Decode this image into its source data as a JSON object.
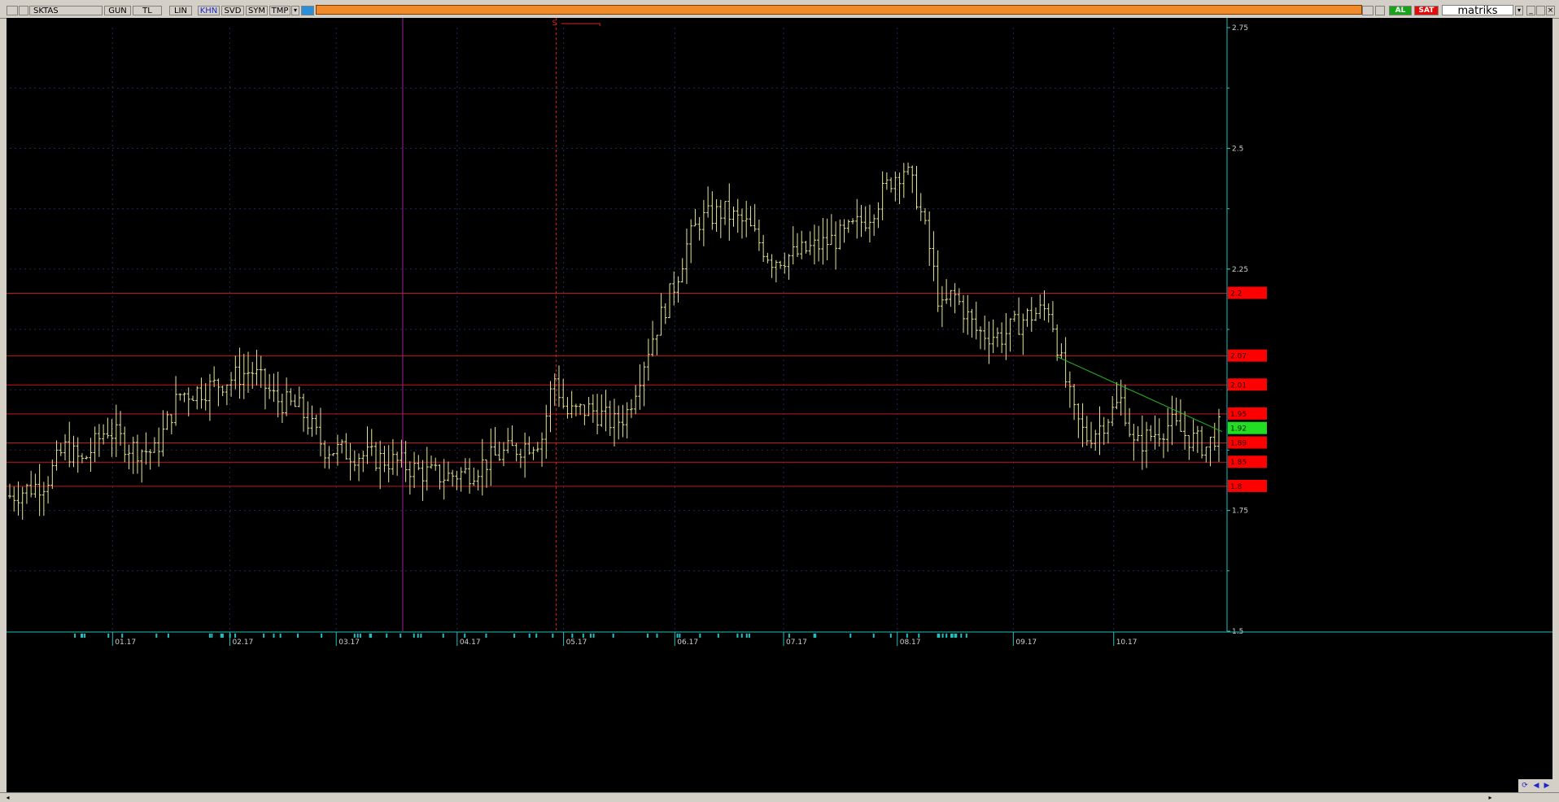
{
  "toolbar": {
    "symbol": "SKTAS",
    "buttons": [
      "GUN",
      "TL",
      "LIN",
      "KHN",
      "SVD",
      "SYM",
      "TMP"
    ],
    "buy_label": "AL",
    "sell_label": "SAT",
    "brand": "matriks"
  },
  "colors": {
    "background": "#000000",
    "bars": "#e6e69a",
    "support_lines": "#c01818",
    "price_tag": "#ff0000",
    "current_tag": "#22dd22",
    "axis": "#20c0c0",
    "trendline": "#22bb22",
    "toolbar_accent": "#f08a2a"
  },
  "chart_data": {
    "type": "ohlc",
    "ylim": [
      1.5,
      2.75
    ],
    "y_ticks": [
      1.5,
      1.75,
      2.25,
      2.5,
      2.75
    ],
    "x_ticks": [
      "01.17",
      "02.17",
      "03.17",
      "04.17",
      "05.17",
      "06.17",
      "07.17",
      "08.17",
      "09.17",
      "10.17"
    ],
    "horizontal_levels": [
      {
        "value": 2.2,
        "label": "2.2"
      },
      {
        "value": 2.07,
        "label": "2.07"
      },
      {
        "value": 2.01,
        "label": "2.01"
      },
      {
        "value": 1.95,
        "label": "1.95"
      },
      {
        "value": 1.89,
        "label": "1.89"
      },
      {
        "value": 1.85,
        "label": "1.85"
      },
      {
        "value": 1.8,
        "label": "1.8"
      }
    ],
    "current_price": {
      "value": 1.92,
      "label": "1.92"
    },
    "marker_label": "S",
    "trendline": {
      "from": [
        "09.17",
        2.07
      ],
      "to": [
        "10.17",
        1.92
      ]
    },
    "anchors": [
      {
        "t": 0.0,
        "v": 1.78
      },
      {
        "t": 0.03,
        "v": 1.81
      },
      {
        "t": 0.045,
        "v": 1.88
      },
      {
        "t": 0.06,
        "v": 1.85
      },
      {
        "t": 0.08,
        "v": 1.92
      },
      {
        "t": 0.1,
        "v": 1.88
      },
      {
        "t": 0.12,
        "v": 1.87
      },
      {
        "t": 0.14,
        "v": 1.99
      },
      {
        "t": 0.16,
        "v": 2.0
      },
      {
        "t": 0.18,
        "v": 2.02
      },
      {
        "t": 0.2,
        "v": 2.04
      },
      {
        "t": 0.22,
        "v": 1.98
      },
      {
        "t": 0.24,
        "v": 1.96
      },
      {
        "t": 0.26,
        "v": 1.88
      },
      {
        "t": 0.28,
        "v": 1.87
      },
      {
        "t": 0.3,
        "v": 1.86
      },
      {
        "t": 0.32,
        "v": 1.85
      },
      {
        "t": 0.34,
        "v": 1.83
      },
      {
        "t": 0.36,
        "v": 1.82
      },
      {
        "t": 0.38,
        "v": 1.83
      },
      {
        "t": 0.4,
        "v": 1.86
      },
      {
        "t": 0.42,
        "v": 1.88
      },
      {
        "t": 0.44,
        "v": 1.9
      },
      {
        "t": 0.45,
        "v": 2.03
      },
      {
        "t": 0.46,
        "v": 1.95
      },
      {
        "t": 0.48,
        "v": 1.96
      },
      {
        "t": 0.5,
        "v": 1.93
      },
      {
        "t": 0.51,
        "v": 1.95
      },
      {
        "t": 0.53,
        "v": 2.1
      },
      {
        "t": 0.55,
        "v": 2.22
      },
      {
        "t": 0.56,
        "v": 2.3
      },
      {
        "t": 0.57,
        "v": 2.35
      },
      {
        "t": 0.59,
        "v": 2.37
      },
      {
        "t": 0.61,
        "v": 2.34
      },
      {
        "t": 0.63,
        "v": 2.27
      },
      {
        "t": 0.65,
        "v": 2.28
      },
      {
        "t": 0.67,
        "v": 2.3
      },
      {
        "t": 0.69,
        "v": 2.32
      },
      {
        "t": 0.71,
        "v": 2.36
      },
      {
        "t": 0.73,
        "v": 2.44
      },
      {
        "t": 0.74,
        "v": 2.46
      },
      {
        "t": 0.75,
        "v": 2.4
      },
      {
        "t": 0.76,
        "v": 2.3
      },
      {
        "t": 0.77,
        "v": 2.16
      },
      {
        "t": 0.78,
        "v": 2.2
      },
      {
        "t": 0.8,
        "v": 2.12
      },
      {
        "t": 0.82,
        "v": 2.11
      },
      {
        "t": 0.84,
        "v": 2.15
      },
      {
        "t": 0.86,
        "v": 2.17
      },
      {
        "t": 0.87,
        "v": 2.05
      },
      {
        "t": 0.88,
        "v": 1.95
      },
      {
        "t": 0.89,
        "v": 1.9
      },
      {
        "t": 0.9,
        "v": 1.92
      },
      {
        "t": 0.92,
        "v": 1.98
      },
      {
        "t": 0.93,
        "v": 1.88
      },
      {
        "t": 0.94,
        "v": 1.9
      },
      {
        "t": 0.96,
        "v": 1.93
      },
      {
        "t": 0.97,
        "v": 1.91
      },
      {
        "t": 0.99,
        "v": 1.88
      },
      {
        "t": 1.0,
        "v": 1.92
      }
    ]
  }
}
